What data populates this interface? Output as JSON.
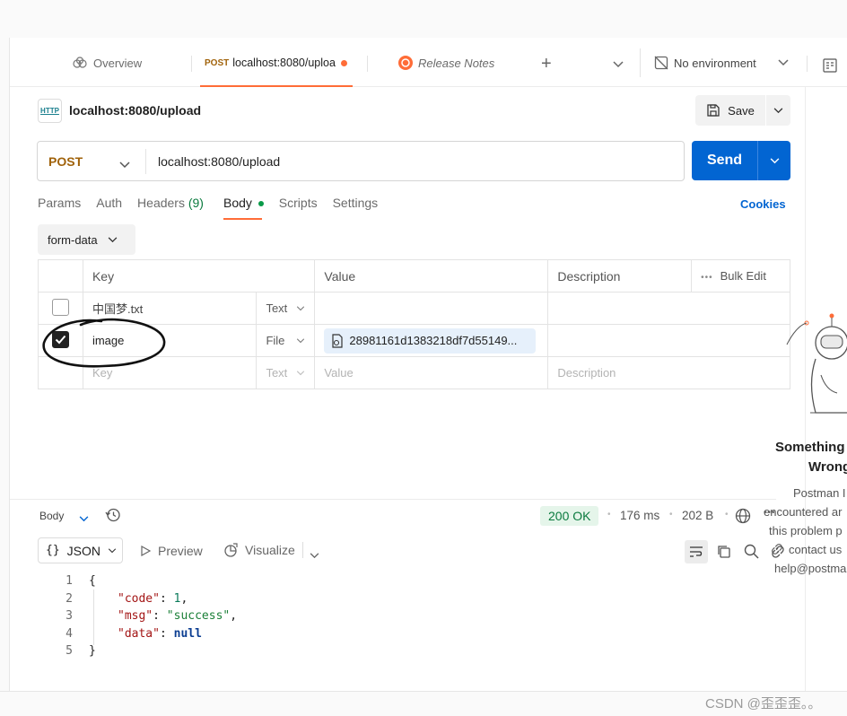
{
  "tabs": {
    "overview": "Overview",
    "active_method": "POST",
    "active_label": "localhost:8080/uploa",
    "release_notes": "Release Notes",
    "environment": "No environment"
  },
  "request": {
    "icon_text": "HTTP",
    "title": "localhost:8080/upload",
    "save": "Save",
    "method": "POST",
    "url": "localhost:8080/upload",
    "send": "Send"
  },
  "subtabs": {
    "params": "Params",
    "auth": "Auth",
    "headers": "Headers",
    "headers_count": "(9)",
    "body": "Body",
    "scripts": "Scripts",
    "settings": "Settings",
    "cookies": "Cookies"
  },
  "body_mode": "form-data",
  "table": {
    "headers": {
      "key": "Key",
      "value": "Value",
      "description": "Description",
      "bulk_edit": "Bulk Edit"
    },
    "rows": [
      {
        "key": "中国梦.txt",
        "type": "Text",
        "value": "",
        "description": "",
        "checked": false
      },
      {
        "key": "image",
        "type": "File",
        "value": "28981161d1383218df7d55149...",
        "description": "",
        "checked": true
      }
    ],
    "new_row": {
      "key": "Key",
      "type": "Text",
      "value": "Value",
      "description": "Description"
    }
  },
  "response": {
    "label": "Body",
    "status": "200 OK",
    "time": "176 ms",
    "size": "202 B",
    "format": "JSON",
    "preview": "Preview",
    "visualize": "Visualize",
    "lines": [
      "1",
      "2",
      "3",
      "4",
      "5"
    ],
    "json": {
      "open": "{",
      "code_key": "\"code\"",
      "code_val": "1",
      "msg_key": "\"msg\"",
      "msg_val": "\"success\"",
      "data_key": "\"data\"",
      "data_val": "null",
      "close": "}"
    }
  },
  "side_panel": {
    "title1": "Something",
    "title2": "Wrong",
    "l1": "Postman I",
    "l2": "encountered ar",
    "l3": "this problem p",
    "l4": "contact us",
    "l5": "help@postma"
  },
  "watermark": "CSDN @歪歪歪。。",
  "colors": {
    "accent": "#ff6c37",
    "send": "#0265d2",
    "status_ok": "#0a7a3e"
  }
}
